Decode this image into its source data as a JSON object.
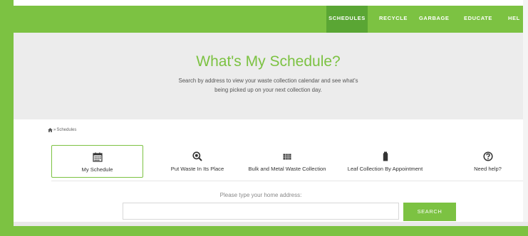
{
  "nav": {
    "items": [
      {
        "label": "SCHEDULES",
        "active": true
      },
      {
        "label": "RECYCLE",
        "active": false
      },
      {
        "label": "GARBAGE",
        "active": false
      },
      {
        "label": "EDUCATE",
        "active": false
      },
      {
        "label": "HEL",
        "active": false
      }
    ]
  },
  "hero": {
    "title": "What's My Schedule?",
    "subtitle_line1": "Search by address to view your waste collection calendar and see what's",
    "subtitle_line2": "being picked up on your next collection day."
  },
  "breadcrumb": {
    "home_icon": "home-icon",
    "separator": "»",
    "current": "Schedules"
  },
  "tabs": [
    {
      "label": "My Schedule",
      "icon": "calendar-icon",
      "active": true
    },
    {
      "label": "Put Waste In Its Place",
      "icon": "magnifier-icon",
      "active": false
    },
    {
      "label": "Bulk and Metal Waste Collection",
      "icon": "grid-icon",
      "active": false
    },
    {
      "label": "Leaf Collection By Appointment",
      "icon": "bag-icon",
      "active": false
    },
    {
      "label": "Need help?",
      "icon": "question-circle-icon",
      "active": false
    }
  ],
  "address": {
    "label": "Please type your home address:",
    "value": "",
    "placeholder": "",
    "button_label": "SEARCH"
  },
  "colors": {
    "brand_green": "#7cc242",
    "active_nav_green": "#5aa634",
    "hero_bg": "#ececec"
  }
}
